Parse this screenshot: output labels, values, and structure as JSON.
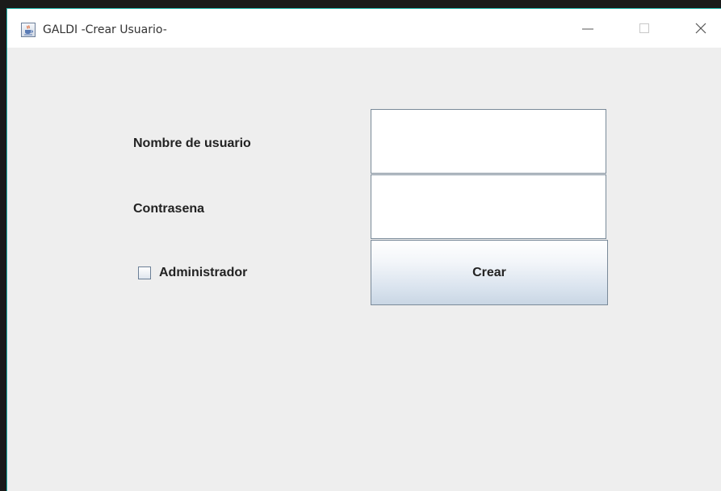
{
  "window": {
    "title": "GALDI -Crear Usuario-",
    "icon": "java-cup-icon",
    "controls": {
      "minimize_icon": "minimize-icon",
      "maximize_icon": "maximize-icon",
      "close_icon": "close-icon"
    }
  },
  "form": {
    "username_label": "Nombre de usuario",
    "username_value": "",
    "password_label": "Contrasena",
    "password_value": "",
    "admin_checkbox_label": "Administrador",
    "admin_checked": false,
    "create_button_label": "Crear"
  },
  "colors": {
    "window_border": "#20b2aa",
    "content_background": "#eeeeee",
    "titlebar_background": "#ffffff"
  }
}
